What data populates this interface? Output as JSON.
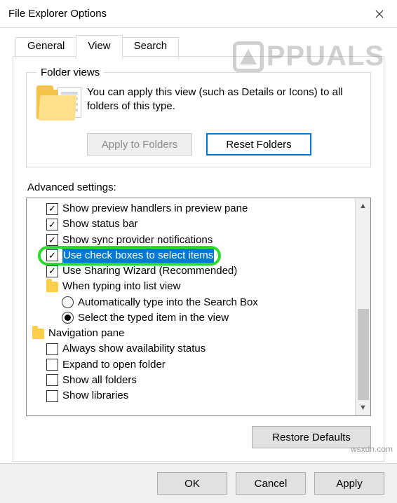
{
  "window": {
    "title": "File Explorer Options"
  },
  "tabs": {
    "general": "General",
    "view": "View",
    "search": "Search"
  },
  "folderViews": {
    "legend": "Folder views",
    "text": "You can apply this view (such as Details or Icons) to all folders of this type.",
    "applyBtn": "Apply to Folders",
    "resetBtn": "Reset Folders"
  },
  "advanced": {
    "label": "Advanced settings:",
    "items": [
      {
        "type": "check",
        "checked": true,
        "label": "Show preview handlers in preview pane",
        "indent": 1
      },
      {
        "type": "check",
        "checked": true,
        "label": "Show status bar",
        "indent": 1
      },
      {
        "type": "check",
        "checked": true,
        "label": "Show sync provider notifications",
        "indent": 1
      },
      {
        "type": "check",
        "checked": true,
        "label": "Use check boxes to select items",
        "indent": 1,
        "highlighted": true
      },
      {
        "type": "check",
        "checked": true,
        "label": "Use Sharing Wizard (Recommended)",
        "indent": 1
      },
      {
        "type": "folder",
        "label": "When typing into list view",
        "indent": 1
      },
      {
        "type": "radio",
        "checked": false,
        "label": "Automatically type into the Search Box",
        "indent": 2
      },
      {
        "type": "radio",
        "checked": true,
        "label": "Select the typed item in the view",
        "indent": 2
      },
      {
        "type": "folder",
        "label": "Navigation pane",
        "indent": 0
      },
      {
        "type": "check",
        "checked": false,
        "label": "Always show availability status",
        "indent": 1
      },
      {
        "type": "check",
        "checked": false,
        "label": "Expand to open folder",
        "indent": 1
      },
      {
        "type": "check",
        "checked": false,
        "label": "Show all folders",
        "indent": 1
      },
      {
        "type": "check",
        "checked": false,
        "label": "Show libraries",
        "indent": 1
      }
    ]
  },
  "buttons": {
    "restore": "Restore Defaults",
    "ok": "OK",
    "cancel": "Cancel",
    "apply": "Apply"
  },
  "watermark": "PPUALS",
  "source": "wsxdn.com"
}
